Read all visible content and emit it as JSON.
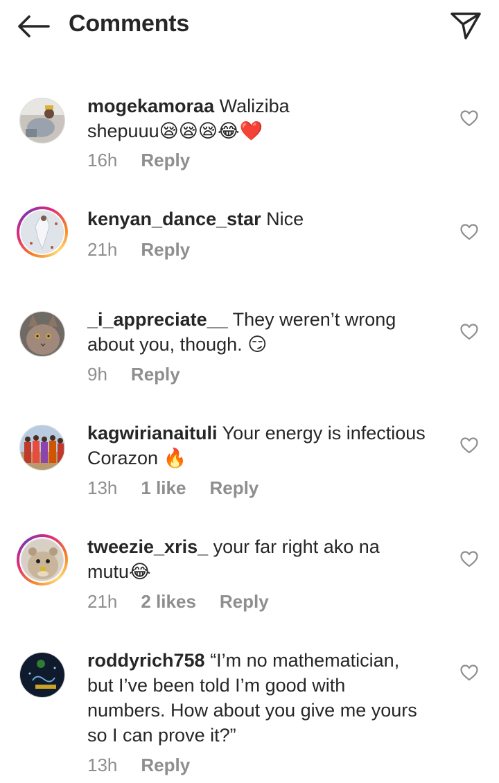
{
  "header": {
    "title": "Comments",
    "back_icon": "arrow-left-icon",
    "share_icon": "send-icon"
  },
  "comments": [
    {
      "username": "mogekamoraa",
      "text": "Waliziba shepuuu😪😪😪😂❤️",
      "text_line1": "Waliziba",
      "text_line2": "shepuuu😪😪😪😂❤️",
      "time": "16h",
      "reply": "Reply",
      "story_ring": false
    },
    {
      "username": "kenyan_dance_star",
      "text": "Nice",
      "time": "21h",
      "reply": "Reply",
      "story_ring": true
    },
    {
      "username": "_i_appreciate__",
      "text_line1": "They weren’t wrong",
      "text_line2": "about you, though. 😏",
      "time": "9h",
      "reply": "Reply",
      "story_ring": false
    },
    {
      "username": "kagwirianaituli",
      "text_line1": "Your energy is infectious",
      "text_line2": "Corazon 🔥",
      "time": "13h",
      "likes": "1 like",
      "reply": "Reply",
      "story_ring": false
    },
    {
      "username": "tweezie_xris_",
      "text_line1": "your far right ako na",
      "text_line2": "mutu😂",
      "time": "21h",
      "likes": "2 likes",
      "reply": "Reply",
      "story_ring": true
    },
    {
      "username": "roddyrich758",
      "text_line1": "“I’m no mathematician,",
      "text_line2": "but I’ve been told I’m good with",
      "text_line3": "numbers. How about you give me yours",
      "text_line4": "so I can prove it?”",
      "time": "13h",
      "reply": "Reply",
      "story_ring": false
    }
  ],
  "colors": {
    "text": "#262626",
    "meta": "#8e8e8e",
    "border": "#dbdbdb"
  }
}
